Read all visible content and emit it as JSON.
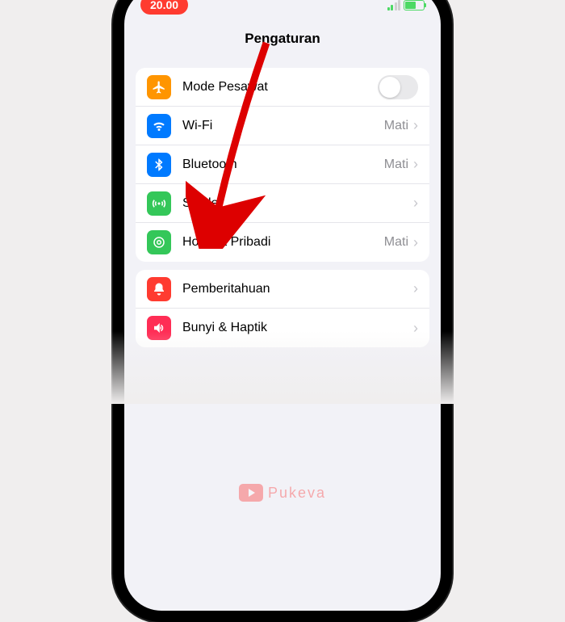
{
  "status": {
    "time": "20.00"
  },
  "header": {
    "title": "Pengaturan"
  },
  "group1": {
    "airplane": {
      "label": "Mode Pesawat"
    },
    "wifi": {
      "label": "Wi-Fi",
      "value": "Mati"
    },
    "bluetooth": {
      "label": "Bluetooth",
      "value": "Mati"
    },
    "cellular": {
      "label": "Seluler"
    },
    "hotspot": {
      "label": "Hotspot Pribadi",
      "value": "Mati"
    }
  },
  "group2": {
    "notifications": {
      "label": "Pemberitahuan"
    },
    "sounds": {
      "label": "Bunyi & Haptik"
    }
  },
  "watermark": {
    "text": "Pukeva"
  }
}
